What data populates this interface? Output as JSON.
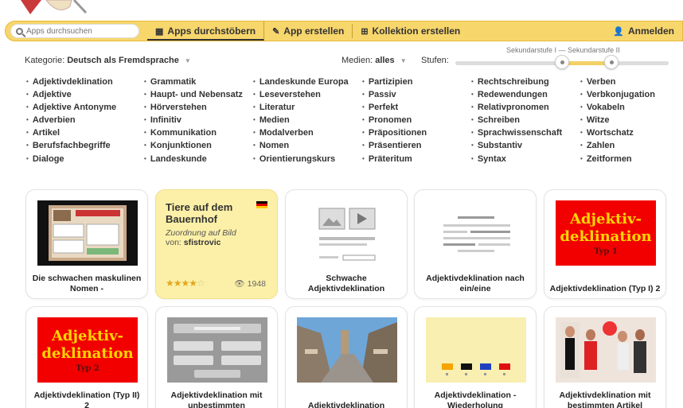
{
  "nav": {
    "search_placeholder": "Apps durchsuchen",
    "browse": "Apps durchstöbern",
    "create_app": "App erstellen",
    "create_collection": "Kollektion erstellen",
    "login": "Anmelden"
  },
  "filters": {
    "category_label": "Kategorie:",
    "category_value": "Deutsch als Fremdsprache",
    "media_label": "Medien:",
    "media_value": "alles",
    "levels_label": "Stufen:",
    "level_range": "Sekundarstufe I — Sekundarstufe II"
  },
  "categories": [
    [
      "Adjektivdeklination",
      "Adjektive",
      "Adjektive Antonyme",
      "Adverbien",
      "Artikel",
      "Berufsfachbegriffe",
      "Dialoge"
    ],
    [
      "Grammatik",
      "Haupt- und Nebensatz",
      "Hörverstehen",
      "Infinitiv",
      "Kommunikation",
      "Konjunktionen",
      "Landeskunde"
    ],
    [
      "Landeskunde Europa",
      "Leseverstehen",
      "Literatur",
      "Medien",
      "Modalverben",
      "Nomen",
      "Orientierungskurs"
    ],
    [
      "Partizipien",
      "Passiv",
      "Perfekt",
      "Pronomen",
      "Präpositionen",
      "Präsentieren",
      "Präteritum"
    ],
    [
      "Rechtschreibung",
      "Redewendungen",
      "Relativpronomen",
      "Schreiben",
      "Sprachwissenschaft",
      "Substantiv",
      "Syntax"
    ],
    [
      "Verben",
      "Verbkonjugation",
      "Vokabeln",
      "Witze",
      "Wortschatz",
      "Zahlen",
      "Zeitformen"
    ]
  ],
  "cards": [
    {
      "title": "Die schwachen maskulinen Nomen -"
    },
    {
      "title": "Tiere auf dem Bauernhof",
      "type": "Zuordnung auf Bild",
      "by_label": "von:",
      "author": "sfistrovic",
      "rating": 4,
      "views": "1948"
    },
    {
      "title": "Schwache Adjektivdeklination"
    },
    {
      "title": "Adjektivdeklination nach ein/eine"
    },
    {
      "title": "Adjektivdeklination (Typ I) 2",
      "thumb_line1": "Adjektiv-",
      "thumb_line2": "deklination",
      "thumb_typ": "Typ 1"
    },
    {
      "title": "Adjektivdeklination (Typ II) 2",
      "thumb_line1": "Adjektiv-",
      "thumb_line2": "deklination",
      "thumb_typ": "Typ 2"
    },
    {
      "title": "Adjektivdeklination mit unbestimmten"
    },
    {
      "title": "Adjektivdeklination"
    },
    {
      "title": "Adjektivdeklination - Wiederholung"
    },
    {
      "title": "Adjektivdeklination mit bestimmten Artikel"
    }
  ],
  "colors": {
    "navbar": "#f7d66c",
    "highlight_card": "#fcf0a8",
    "red_thumb": "#f20000",
    "gold_text": "#ffd700"
  }
}
